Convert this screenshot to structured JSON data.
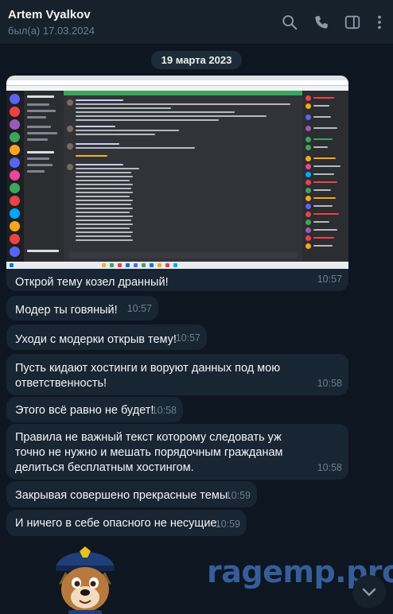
{
  "header": {
    "name": "Artem Vyalkov",
    "status": "был(а) 17.03.2024",
    "icons": [
      "search-icon",
      "phone-icon",
      "sidebar-toggle-icon",
      "more-icon"
    ]
  },
  "chat": {
    "date": "19 марта 2023",
    "messages": [
      {
        "text": "Открой тему козел дранный!",
        "time": "10:57"
      },
      {
        "text": "Модер ты говяный!",
        "time": "10:57"
      },
      {
        "text": "Уходи с модерки открыв тему!",
        "time": "10:57"
      },
      {
        "text": "Пусть кидают хостинги и воруют данных под мою ответственность!",
        "time": "10:58"
      },
      {
        "text": "Этого всё равно не будет!",
        "time": "10:58"
      },
      {
        "text": "Правила не важный текст которому следовать уж точно не нужно  и мешать порядочным гражданам делиться бесплатным хостингом.",
        "time": "10:58"
      },
      {
        "text": "Закрывая совершено прекрасные темы.",
        "time": "10:59"
      },
      {
        "text": "И ничего в себе опасного не несущие.",
        "time": "10:59"
      }
    ]
  },
  "watermark": "ragemp.pro",
  "colors": {
    "background": "#0e1621",
    "header": "#17212b",
    "bubble": "#182533",
    "time": "#6d7f8f",
    "accent": "#3ba55c"
  }
}
